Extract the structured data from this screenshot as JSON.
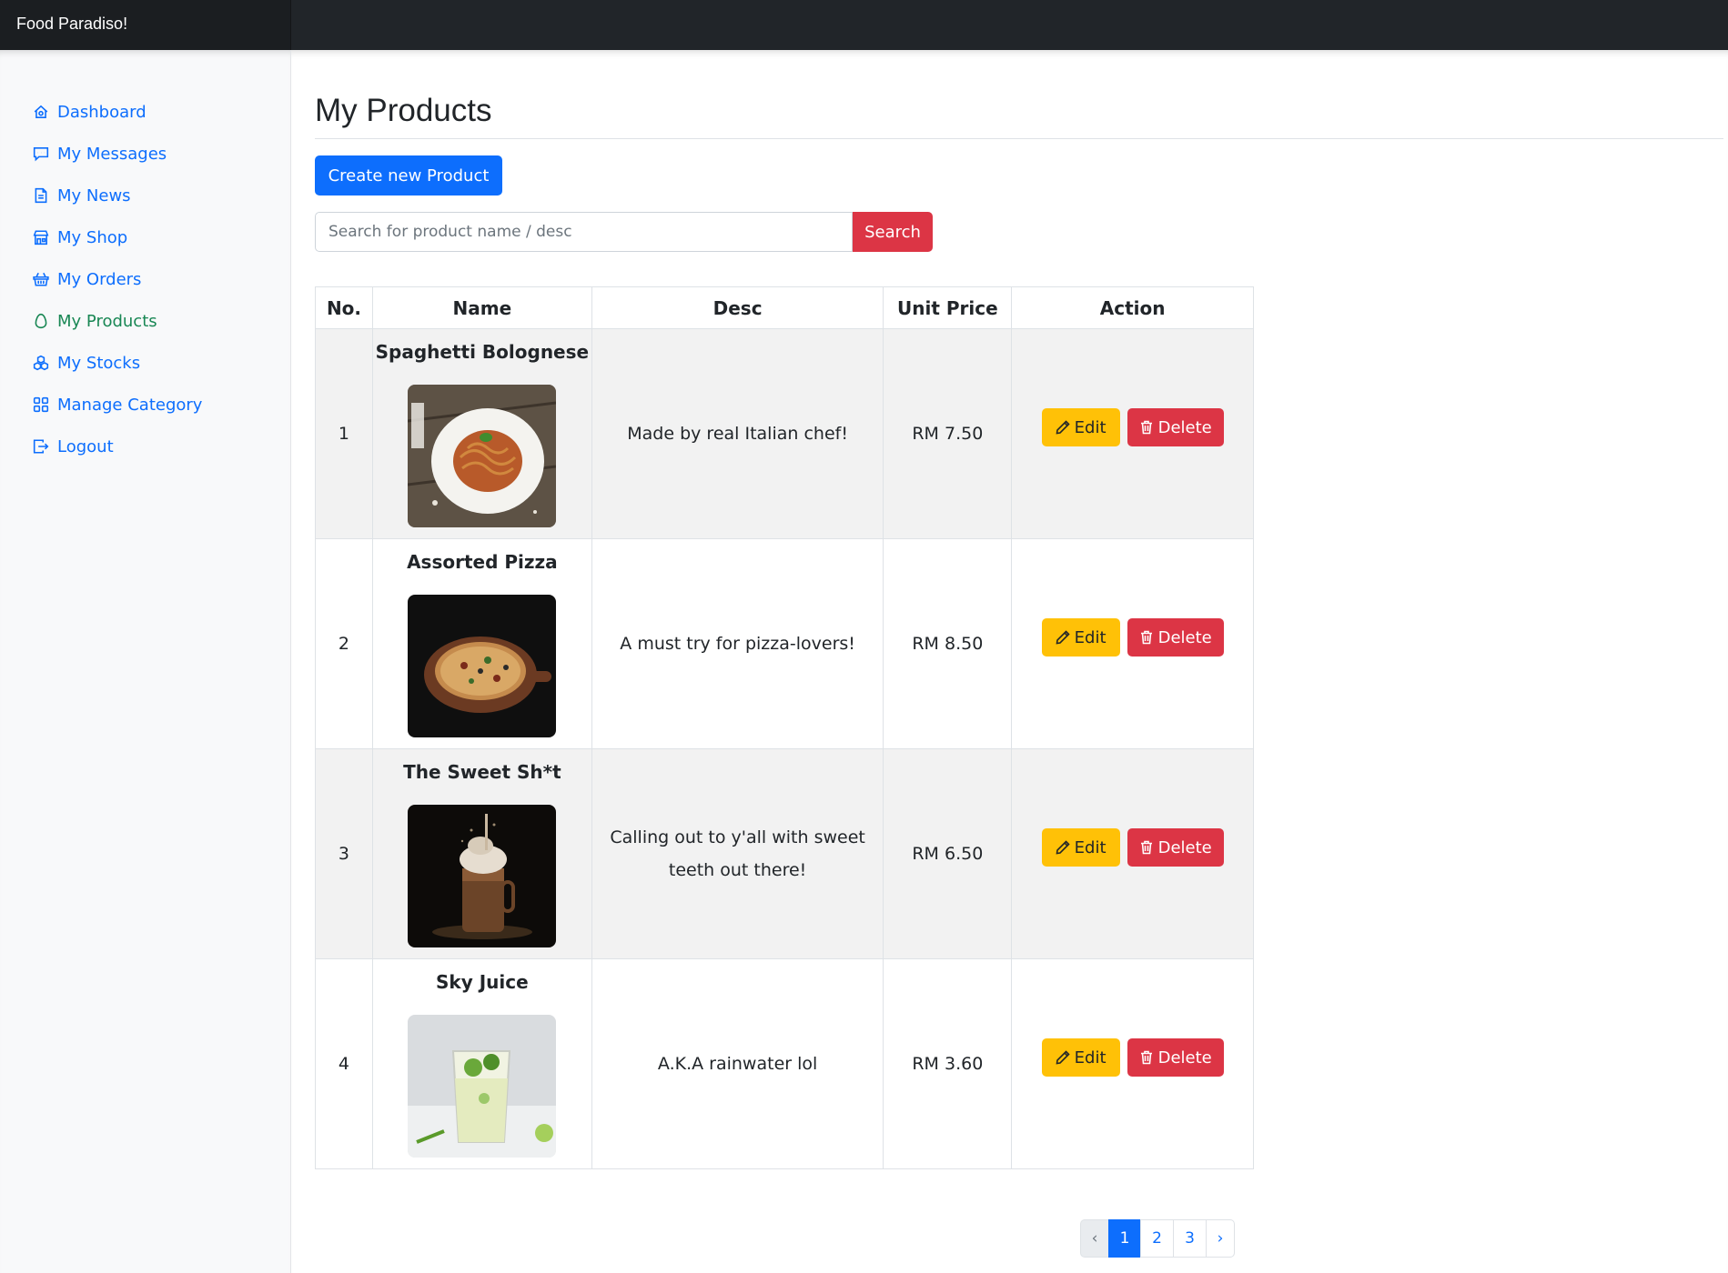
{
  "app": {
    "brand": "Food Paradiso!"
  },
  "sidebar": {
    "items": [
      {
        "label": "Dashboard",
        "icon": "dashboard-icon"
      },
      {
        "label": "My Messages",
        "icon": "messages-icon"
      },
      {
        "label": "My News",
        "icon": "news-icon"
      },
      {
        "label": "My Shop",
        "icon": "shop-icon"
      },
      {
        "label": "My Orders",
        "icon": "basket-icon"
      },
      {
        "label": "My Products",
        "icon": "egg-icon",
        "active": true
      },
      {
        "label": "My Stocks",
        "icon": "boxes-icon"
      },
      {
        "label": "Manage Category",
        "icon": "grid-icon"
      },
      {
        "label": "Logout",
        "icon": "logout-icon"
      }
    ]
  },
  "main": {
    "title": "My Products",
    "create_button": "Create new Product",
    "search": {
      "placeholder": "Search for product name / desc",
      "value": "",
      "button": "Search"
    },
    "table": {
      "headers": [
        "No.",
        "Name",
        "Desc",
        "Unit Price",
        "Action"
      ],
      "rows": [
        {
          "no": "1",
          "name": "Spaghetti Bolognese",
          "desc": "Made by real Italian chef!",
          "price": "RM 7.50",
          "image": "spaghetti-photo"
        },
        {
          "no": "2",
          "name": "Assorted Pizza",
          "desc": "A must try for pizza-lovers!",
          "price": "RM 8.50",
          "image": "pizza-photo"
        },
        {
          "no": "3",
          "name": "The Sweet Sh*t",
          "desc": "Calling out to y'all with sweet teeth out there!",
          "price": "RM 6.50",
          "image": "milkshake-photo"
        },
        {
          "no": "4",
          "name": "Sky Juice",
          "desc": "A.K.A rainwater lol",
          "price": "RM 3.60",
          "image": "juice-photo"
        }
      ],
      "edit_label": "Edit",
      "delete_label": "Delete"
    },
    "pagination": {
      "prev": "‹",
      "pages": [
        "1",
        "2",
        "3"
      ],
      "current": "1",
      "next": "›"
    }
  },
  "colors": {
    "topbar": "#212529",
    "primary": "#0d6efd",
    "danger": "#dc3545",
    "warning": "#ffc107",
    "active_link": "#198754"
  }
}
